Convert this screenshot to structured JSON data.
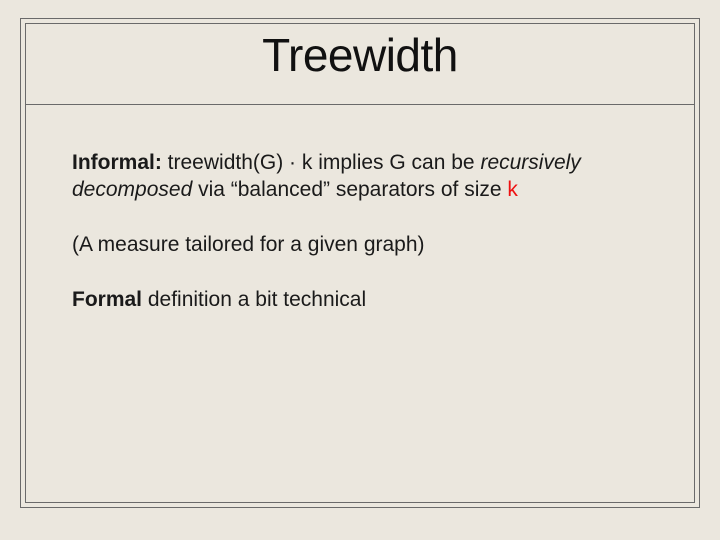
{
  "slide": {
    "title": "Treewidth",
    "p1": {
      "lead": "Informal:",
      "expr": " treewidth(G) · k",
      "afterExpr": " implies G can be ",
      "recursive": "recursively decomposed",
      "via": " via “balanced” separators of size ",
      "k": "k"
    },
    "p2": "(A measure tailored for a given graph)",
    "p3": {
      "lead": "Formal",
      "rest": " definition a bit technical"
    }
  }
}
